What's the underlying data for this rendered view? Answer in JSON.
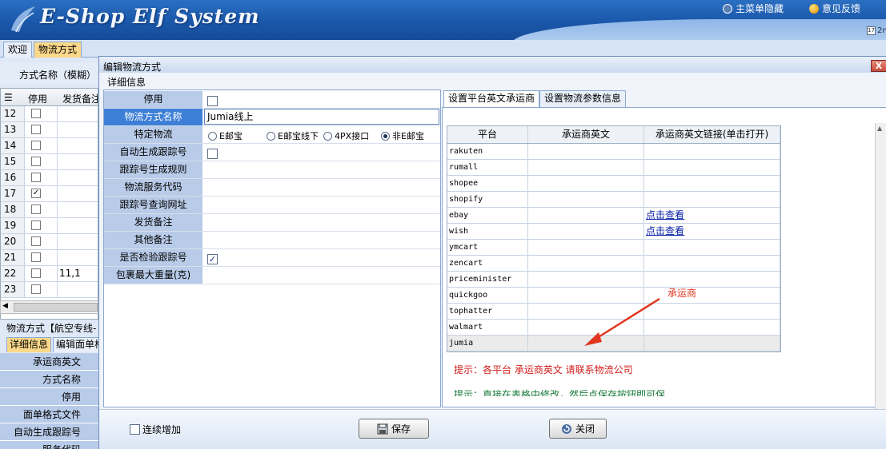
{
  "app": {
    "logo_text": "E-Shop Elf System",
    "menu_hide_label": "主菜单隐藏",
    "feedback_label": "意见反馈",
    "date_snippet": "2n",
    "calendar_day": "17"
  },
  "main_tabs": [
    {
      "label": "欢迎",
      "active": false
    },
    {
      "label": "物流方式",
      "active": true
    }
  ],
  "bg_page": {
    "filter_label": "方式名称（模糊）",
    "grid_header": {
      "col1": "停用",
      "col2": "发货备注"
    },
    "rows": [
      {
        "num": "12",
        "checked": "",
        "note": ""
      },
      {
        "num": "13",
        "checked": "",
        "note": ""
      },
      {
        "num": "14",
        "checked": "",
        "note": ""
      },
      {
        "num": "15",
        "checked": "",
        "note": ""
      },
      {
        "num": "16",
        "checked": "",
        "note": ""
      },
      {
        "num": "17",
        "checked": "✓",
        "note": ""
      },
      {
        "num": "18",
        "checked": "",
        "note": ""
      },
      {
        "num": "19",
        "checked": "",
        "note": ""
      },
      {
        "num": "20",
        "checked": "",
        "note": ""
      },
      {
        "num": "21",
        "checked": "",
        "note": ""
      },
      {
        "num": "22",
        "checked": "",
        "note": "11,1"
      },
      {
        "num": "23",
        "checked": "",
        "note": ""
      }
    ],
    "section_title": "物流方式【航空专线-",
    "tabs": [
      {
        "label": "详细信息"
      },
      {
        "label": "编辑面单格"
      }
    ],
    "fields": [
      "承运商英文",
      "方式名称",
      "停用",
      "面单格式文件",
      "自动生成跟踪号",
      "服务代码"
    ]
  },
  "dialog": {
    "title": "编辑物流方式",
    "subtitle": "详细信息",
    "close_label": "X",
    "form": {
      "disabled_label": "停用",
      "name_label": "物流方式名称",
      "name_value": "Jumia线上",
      "special_label": "特定物流",
      "special_options": [
        "E邮宝",
        "E邮宝线下",
        "4PX接口",
        "非E邮宝"
      ],
      "auto_track_label": "自动生成跟踪号",
      "track_rule_label": "跟踪号生成规则",
      "service_code_label": "物流服务代码",
      "track_url_label": "跟踪号查询网址",
      "ship_note_label": "发货备注",
      "other_note_label": "其他备注",
      "verify_track_label": "是否检验跟踪号",
      "verify_track_mark": "✓",
      "max_weight_label": "包裹最大重量(克)"
    },
    "right_tabs": [
      {
        "label": "设置平台英文承运商",
        "active": true
      },
      {
        "label": "设置物流参数信息",
        "active": false
      }
    ],
    "carrier_grid": {
      "headers": [
        "平台",
        "承运商英文",
        "承运商英文链接(单击打开)"
      ],
      "rows": [
        {
          "platform": "rakuten",
          "carrier": "",
          "link": ""
        },
        {
          "platform": "rumall",
          "carrier": "",
          "link": ""
        },
        {
          "platform": "shopee",
          "carrier": "",
          "link": ""
        },
        {
          "platform": "shopify",
          "carrier": "",
          "link": ""
        },
        {
          "platform": "ebay",
          "carrier": "",
          "link": "点击查看"
        },
        {
          "platform": "wish",
          "carrier": "",
          "link": "点击查看"
        },
        {
          "platform": "ymcart",
          "carrier": "",
          "link": ""
        },
        {
          "platform": "zencart",
          "carrier": "",
          "link": ""
        },
        {
          "platform": "priceminister",
          "carrier": "",
          "link": ""
        },
        {
          "platform": "quickgoo",
          "carrier": "",
          "link": ""
        },
        {
          "platform": "tophatter",
          "carrier": "",
          "link": ""
        },
        {
          "platform": "walmart",
          "carrier": "",
          "link": ""
        },
        {
          "platform": "jumia",
          "carrier": "",
          "link": ""
        }
      ]
    },
    "hint_red": "提示：各平台 承运商英文 请联系物流公司",
    "hint_green": "提示：直接在表格中修改，然后点保存按钮即可保",
    "annotation": "承运商",
    "continue_label": "连续增加",
    "save_label": "保存",
    "close_btn_label": "关闭"
  },
  "colors": {
    "banner": "#1a57aa",
    "active_tab": "#fbd88a",
    "label_bg": "#b8cbe8",
    "selected_label": "#3d7fd6",
    "link": "#0b21a8",
    "annotation": "#e0361e"
  }
}
